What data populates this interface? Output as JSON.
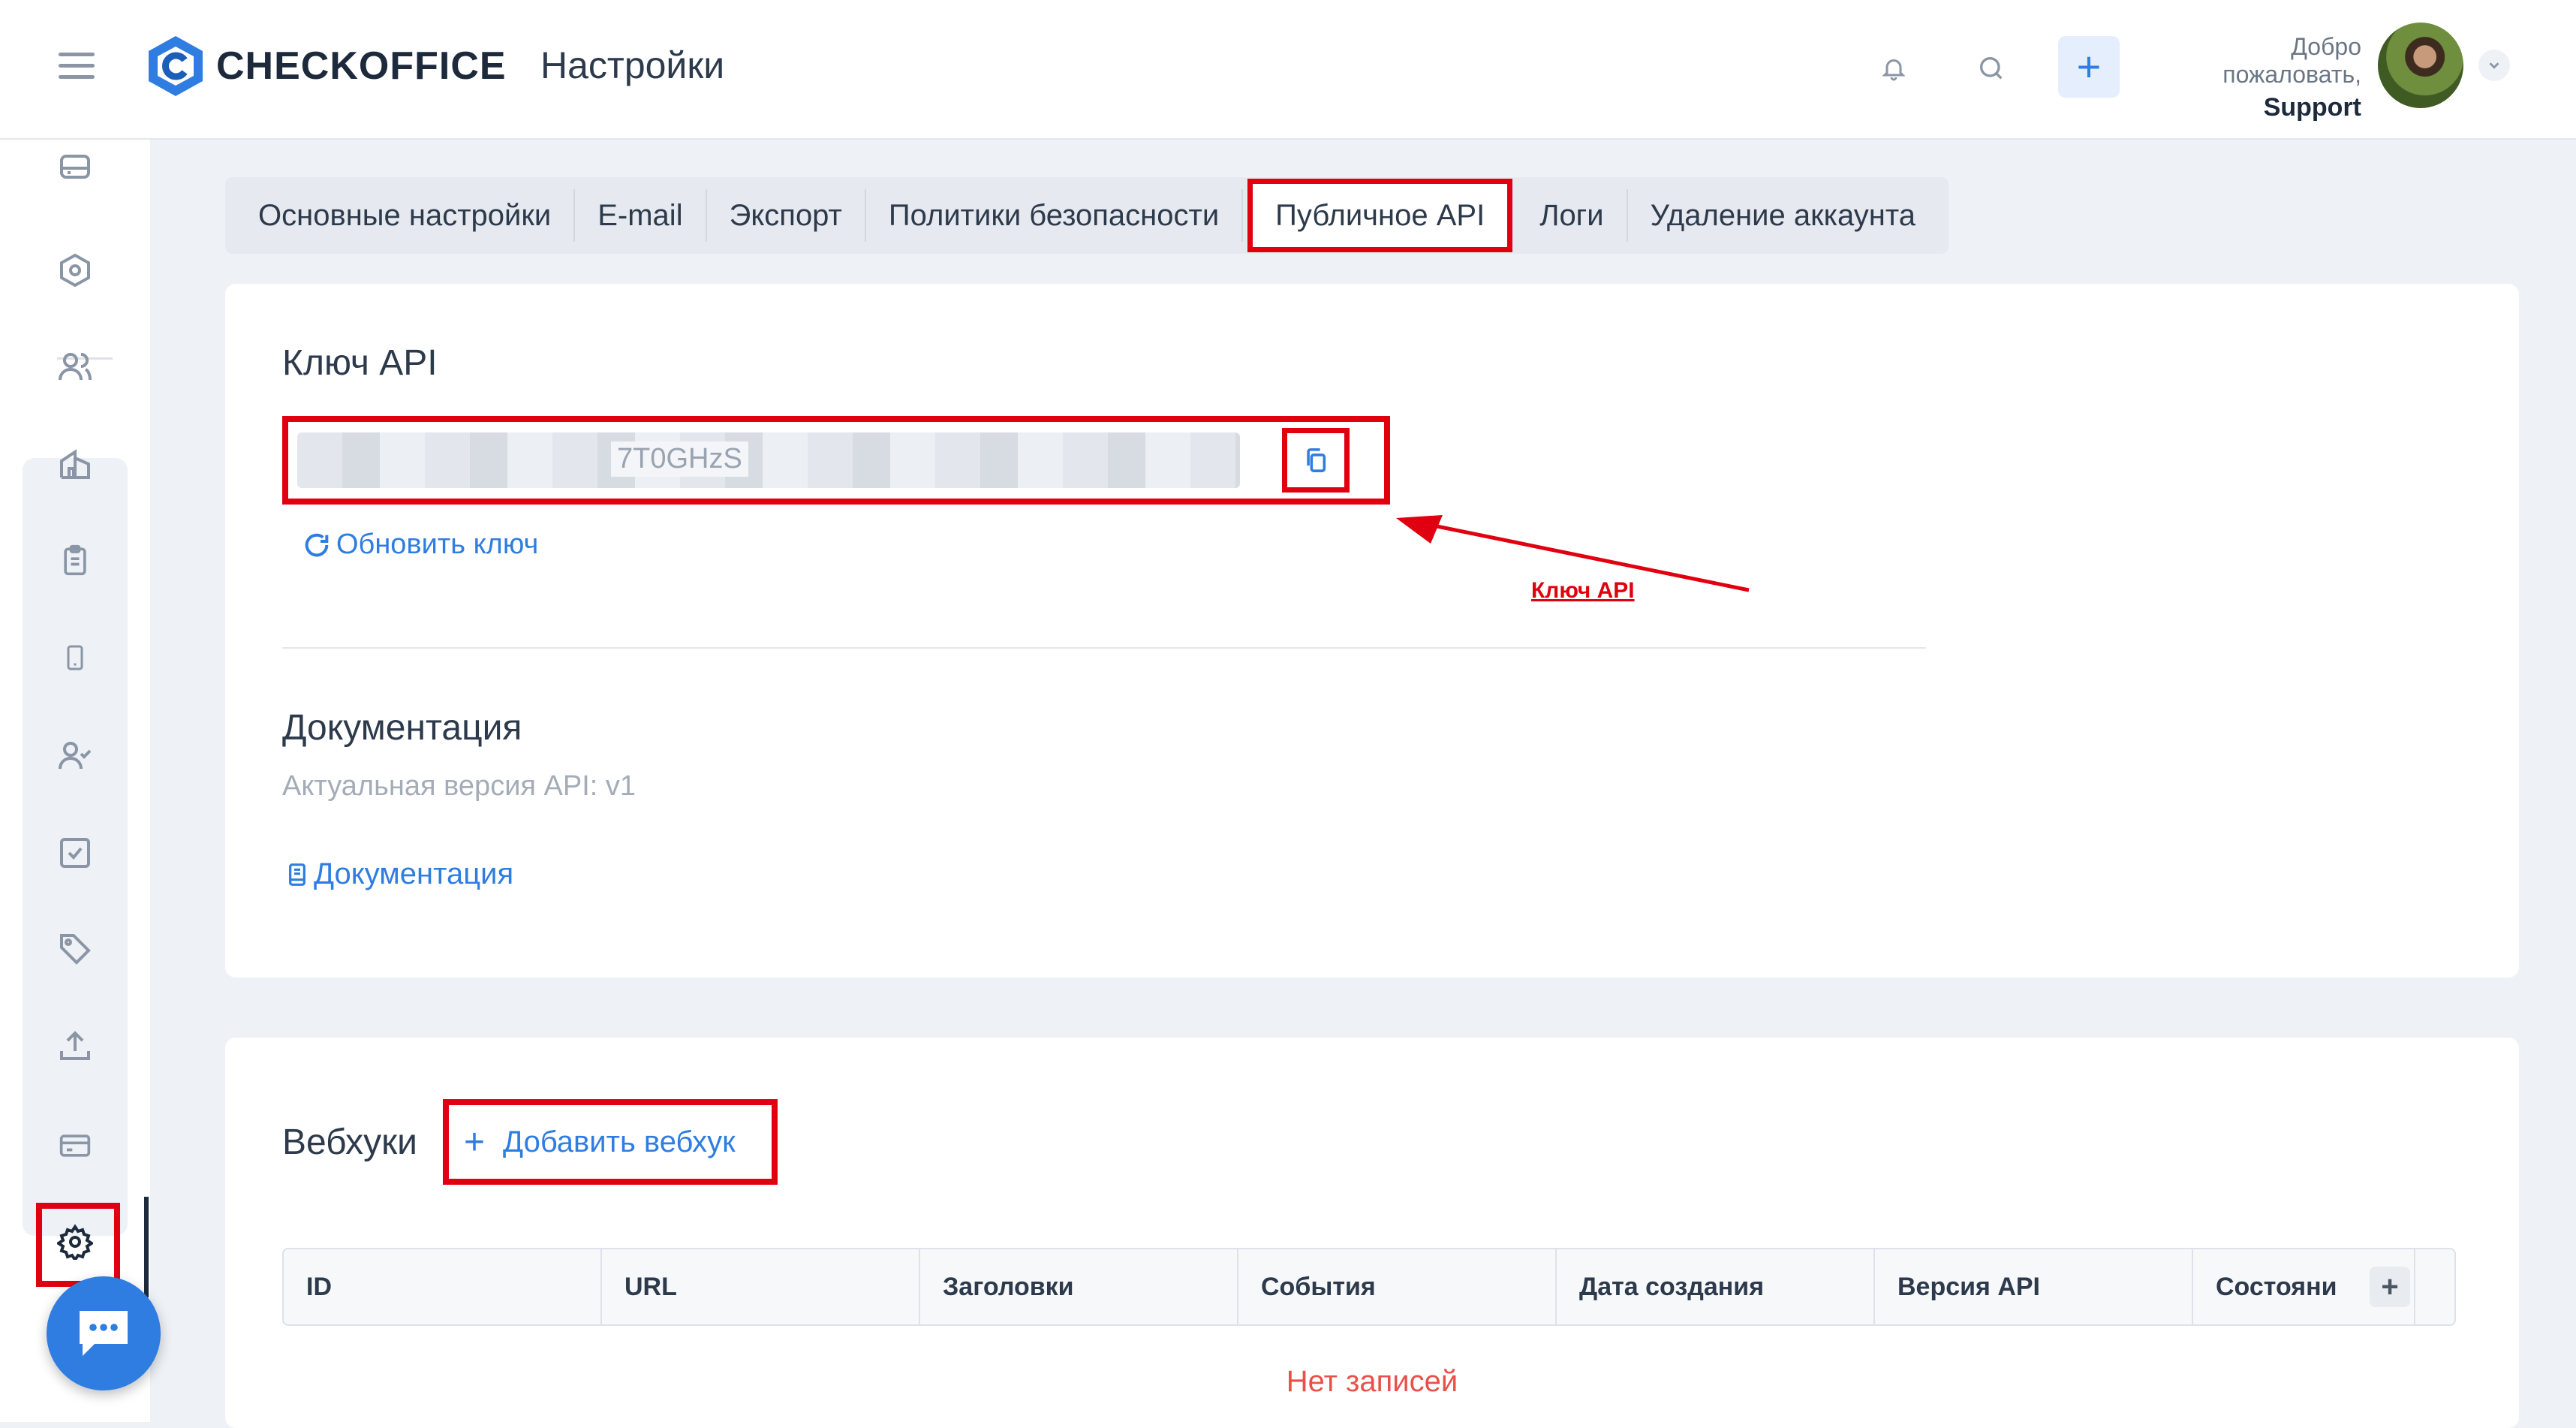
{
  "app": {
    "logo_text": "CHECKOFFICE",
    "page_title": "Настройки",
    "welcome_text": "Добро пожаловать,",
    "user_name": "Support"
  },
  "topbar_icons": [
    "menu-icon",
    "bell-icon",
    "search-icon",
    "plus-icon",
    "chevron-down-icon"
  ],
  "sidebar": {
    "items": [
      {
        "icon": "inbox-icon"
      },
      {
        "icon": "hexagon-icon"
      },
      {
        "icon": "users-icon"
      },
      {
        "icon": "building-icon"
      },
      {
        "icon": "clipboard-icon"
      },
      {
        "icon": "phone-icon"
      },
      {
        "icon": "user-check-icon"
      },
      {
        "icon": "checkbox-icon"
      },
      {
        "icon": "tag-icon"
      },
      {
        "icon": "upload-icon"
      },
      {
        "icon": "card-icon"
      },
      {
        "icon": "gear-icon",
        "active": true
      }
    ]
  },
  "tabs": [
    {
      "label": "Основные настройки"
    },
    {
      "label": "E-mail"
    },
    {
      "label": "Экспорт"
    },
    {
      "label": "Политики безопасности"
    },
    {
      "label": "Публичное API",
      "active": true
    },
    {
      "label": "Логи"
    },
    {
      "label": "Удаление аккаунта"
    }
  ],
  "api_key": {
    "title": "Ключ API",
    "visible_fragment": "7T0GHzS",
    "refresh_label": "Обновить ключ",
    "annotation": "Ключ API"
  },
  "docs": {
    "title": "Документация",
    "version_text": "Актуальная версия API: v1",
    "link_label": "Документация"
  },
  "webhooks": {
    "title": "Вебхуки",
    "add_label": "Добавить вебхук",
    "columns": [
      "ID",
      "URL",
      "Заголовки",
      "События",
      "Дата создания",
      "Версия API",
      "Состояни"
    ],
    "empty_text": "Нет записей"
  },
  "colors": {
    "accent": "#2f7de1",
    "highlight": "#e0000f",
    "empty_text": "#e8514a"
  }
}
